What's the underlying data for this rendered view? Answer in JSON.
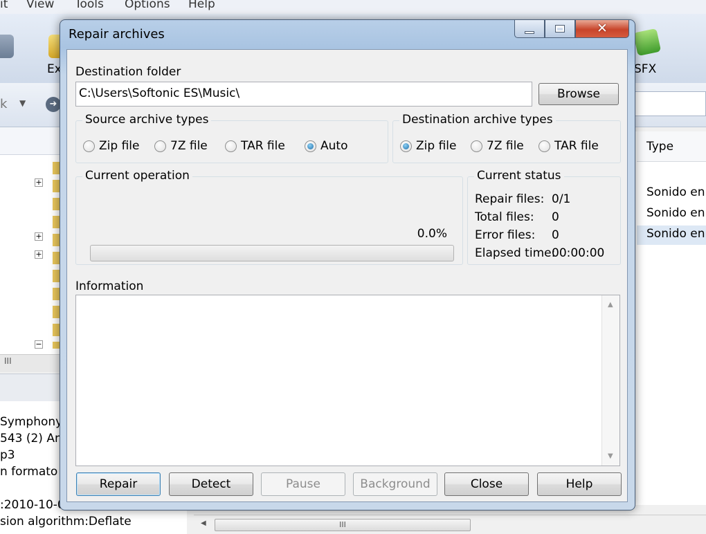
{
  "background": {
    "menu": [
      "it",
      "View",
      "Tools",
      "Options",
      "Help"
    ],
    "toolbar_labels": [
      "Ex",
      "SFX"
    ],
    "nav_back": "k",
    "list_header": "Type",
    "list_rows": [
      "Sonido en",
      "Sonido en",
      "Sonido en"
    ],
    "details": [
      "Symphony",
      "543 (2) An",
      "p3",
      "n formato",
      "",
      ":2010-10-0",
      "sion algorithm:Deflate"
    ],
    "scroll_grip": "III"
  },
  "dialog": {
    "title": "Repair archives",
    "destination_folder_label": "Destination folder",
    "destination_folder_value": "C:\\Users\\Softonic ES\\Music\\",
    "browse_label": "Browse",
    "source_types": {
      "title": "Source archive types",
      "options": [
        "Zip file",
        "7Z file",
        "TAR file",
        "Auto"
      ],
      "selected": "Auto"
    },
    "destination_types": {
      "title": "Destination archive types",
      "options": [
        "Zip file",
        "7Z file",
        "TAR file"
      ],
      "selected": "Zip file"
    },
    "current_operation": {
      "title": "Current operation",
      "percent_text": "0.0%",
      "progress": 0
    },
    "current_status": {
      "title": "Current status",
      "rows": [
        {
          "label": "Repair files:",
          "value": "0/1"
        },
        {
          "label": "Total files:",
          "value": "0"
        },
        {
          "label": "Error files:",
          "value": "0"
        },
        {
          "label": "Elapsed time:",
          "value": "00:00:00"
        }
      ]
    },
    "information_label": "Information",
    "buttons": {
      "repair": "Repair",
      "detect": "Detect",
      "pause": "Pause",
      "background": "Background",
      "close": "Close",
      "help": "Help"
    }
  },
  "colors": {
    "title_gradient": "#a9c4e2",
    "close_button": "#c8452b",
    "radio_selected": "#1b6ea8",
    "default_button_border": "#3c7fb1"
  }
}
